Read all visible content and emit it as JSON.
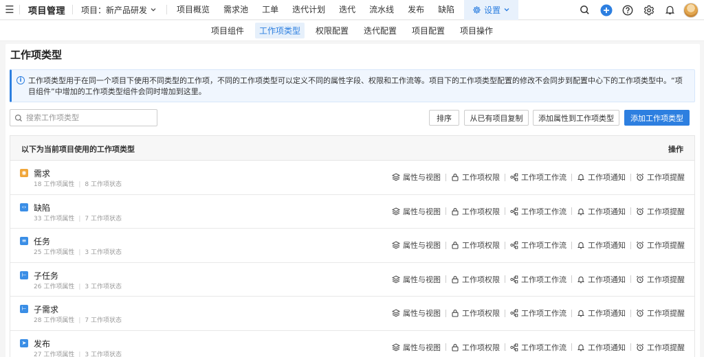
{
  "nav": {
    "project_title": "项目管理",
    "project_select": "项目：新产品研发",
    "items": [
      "项目概览",
      "需求池",
      "工单",
      "迭代计划",
      "迭代",
      "流水线",
      "发布",
      "缺陷"
    ],
    "settings_label": "设置"
  },
  "subnav": {
    "items": [
      "项目组件",
      "工作项类型",
      "权限配置",
      "迭代配置",
      "项目配置",
      "项目操作"
    ],
    "active": "工作项类型"
  },
  "page": {
    "title": "工作项类型",
    "info": "工作项类型用于在同一个项目下使用不同类型的工作项，不同的工作项类型可以定义不同的属性字段、权限和工作流等。项目下的工作项类型配置的修改不会同步到配置中心下的工作项类型中。“项目组件”中增加的工作项类型组件会同时增加到这里。",
    "search_placeholder": "搜索工作项类型"
  },
  "buttons": {
    "sort": "排序",
    "copy": "从已有项目复制",
    "add_attr": "添加属性到工作项类型",
    "add_type": "添加工作项类型"
  },
  "table": {
    "header_left": "以下为当前项目使用的工作项类型",
    "header_right": "操作",
    "actions": [
      "属性与视图",
      "工作项权限",
      "工作项工作流",
      "工作项通知",
      "工作项提醒"
    ],
    "rows": [
      {
        "name": "需求",
        "attrs": "18 工作项属性",
        "states": "8 工作项状态",
        "icon": "bulb-icon",
        "color": "#f0a63a"
      },
      {
        "name": "缺陷",
        "attrs": "33 工作项属性",
        "states": "7 工作项状态",
        "icon": "bug-icon",
        "color": "#3a8ee6"
      },
      {
        "name": "任务",
        "attrs": "25 工作项属性",
        "states": "3 工作项状态",
        "icon": "task-icon",
        "color": "#3a8ee6"
      },
      {
        "name": "子任务",
        "attrs": "26 工作项属性",
        "states": "3 工作项状态",
        "icon": "subtask-icon",
        "color": "#3a8ee6"
      },
      {
        "name": "子需求",
        "attrs": "28 工作项属性",
        "states": "7 工作项状态",
        "icon": "subreq-icon",
        "color": "#3a8ee6"
      },
      {
        "name": "发布",
        "attrs": "27 工作项属性",
        "states": "3 工作项状态",
        "icon": "send-icon",
        "color": "#3a8ee6"
      }
    ]
  }
}
